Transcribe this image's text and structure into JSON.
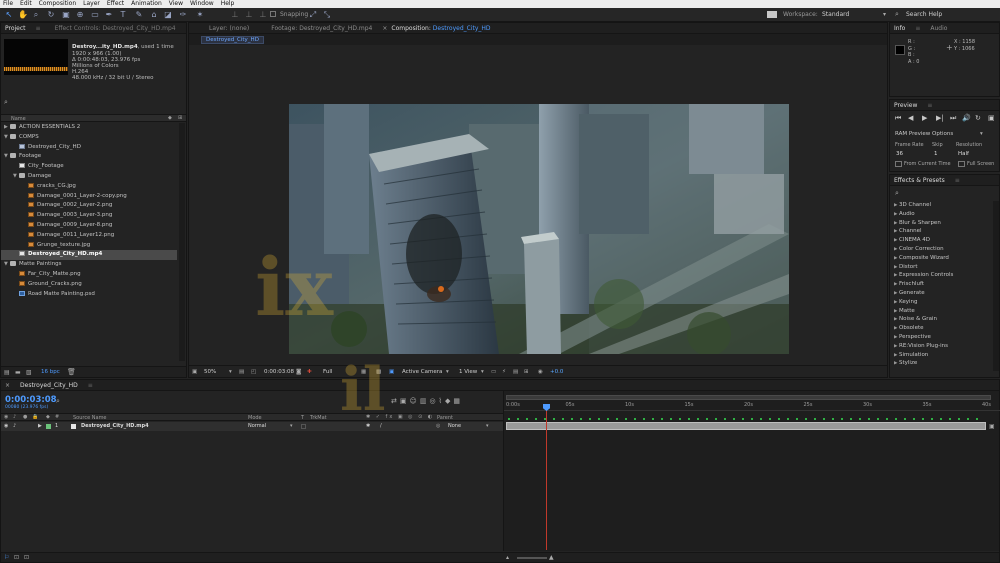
{
  "menu": [
    "File",
    "Edit",
    "Composition",
    "Layer",
    "Effect",
    "Animation",
    "View",
    "Window",
    "Help"
  ],
  "toolbar": {
    "tool_icons": [
      "selection-tool",
      "hand-tool",
      "zoom-tool",
      "rotate-tool",
      "camera-tool",
      "pan-behind-tool",
      "mask-tool",
      "pen-tool",
      "type-tool",
      "brush-tool",
      "clone-stamp-tool",
      "eraser-tool",
      "roto-brush-tool",
      "puppet-tool"
    ],
    "snapping_label": "Snapping",
    "workspace_label": "Workspace:",
    "workspace_value": "Standard",
    "search_placeholder": "Search Help"
  },
  "project_panel": {
    "tabs": [
      "Project",
      "Effect Controls: Destroyed_City_HD.mp4"
    ],
    "selected_name": "Destroy...ity_HD.mp4",
    "used_text": ", used 1 time",
    "meta": [
      "1920 x 966 (1.00)",
      "Δ 0:00:48:03, 23.976 fps",
      "Millions of Colors",
      "H.264",
      "48.000 kHz / 32 bit U / Stereo"
    ],
    "column_name": "Name",
    "items": [
      {
        "level": 0,
        "twirl": "right",
        "type": "folder",
        "name": "ACTION ESSENTIALS 2"
      },
      {
        "level": 0,
        "twirl": "down",
        "type": "folder",
        "name": "COMPS"
      },
      {
        "level": 1,
        "twirl": "",
        "type": "comp",
        "name": "Destroyed_City_HD"
      },
      {
        "level": 0,
        "twirl": "down",
        "type": "folder",
        "name": "Footage"
      },
      {
        "level": 1,
        "twirl": "",
        "type": "vid",
        "name": "City_Footage"
      },
      {
        "level": 1,
        "twirl": "down",
        "type": "folder",
        "name": "Damage"
      },
      {
        "level": 2,
        "twirl": "",
        "type": "img",
        "name": "cracks_CG.jpg"
      },
      {
        "level": 2,
        "twirl": "",
        "type": "img",
        "name": "Damage_0001_Layer-2-copy.png"
      },
      {
        "level": 2,
        "twirl": "",
        "type": "img",
        "name": "Damage_0002_Layer-2.png"
      },
      {
        "level": 2,
        "twirl": "",
        "type": "img",
        "name": "Damage_0003_Layer-3.png"
      },
      {
        "level": 2,
        "twirl": "",
        "type": "img",
        "name": "Damage_0009_Layer-8.png"
      },
      {
        "level": 2,
        "twirl": "",
        "type": "img",
        "name": "Damage_0011_Layer12.png"
      },
      {
        "level": 2,
        "twirl": "",
        "type": "img",
        "name": "Grunge_texture.jpg"
      },
      {
        "level": 1,
        "twirl": "",
        "type": "vid",
        "name": "Destroyed_City_HD.mp4",
        "selected": true
      },
      {
        "level": 0,
        "twirl": "down",
        "type": "folder",
        "name": "Matte Paintings"
      },
      {
        "level": 1,
        "twirl": "",
        "type": "img",
        "name": "Far_City_Matte.png"
      },
      {
        "level": 1,
        "twirl": "",
        "type": "img",
        "name": "Ground_Cracks.png"
      },
      {
        "level": 1,
        "twirl": "",
        "type": "psd",
        "name": "Road Matte Painting.psd"
      }
    ],
    "bpc": "16 bpc"
  },
  "viewer": {
    "tabs": [
      {
        "label": "Layer: (none)"
      },
      {
        "label": "Footage: Destroyed_City_HD.mp4"
      },
      {
        "label": "Composition: ",
        "highlight": "Destroyed_City_HD"
      }
    ],
    "sub_tab": "Destroyed_City_HD",
    "zoom": "50%",
    "timecode": "0:00:03:08",
    "resolution": "Full",
    "camera": "Active Camera",
    "views": "1 View",
    "exposure": "+0.0"
  },
  "info_panel": {
    "tabs": [
      "Info",
      "Audio"
    ],
    "channels": [
      "R :",
      "G :",
      "B :",
      "A : 0"
    ],
    "x": "X : 1158",
    "y": "Y : 1066"
  },
  "preview_panel": {
    "title": "Preview",
    "ram_options": "RAM Preview Options",
    "frame_rate_label": "Frame Rate",
    "skip_label": "Skip",
    "resolution_label": "Resolution",
    "frame_rate_value": "36",
    "skip_value": "1",
    "resolution_value": "Half",
    "from_current": "From Current Time",
    "full_screen": "Full Screen"
  },
  "effects_panel": {
    "title": "Effects & Presets",
    "categories": [
      "3D Channel",
      "Audio",
      "Blur & Sharpen",
      "Channel",
      "CINEMA 4D",
      "Color Correction",
      "Composite Wizard",
      "Distort",
      "Expression Controls",
      "Frischluft",
      "Generate",
      "Keying",
      "Matte",
      "Noise & Grain",
      "Obsolete",
      "Perspective",
      "RE:Vision Plug-ins",
      "Simulation",
      "Stylize"
    ]
  },
  "timeline": {
    "tab": "Destroyed_City_HD",
    "timecode": "0:00:03:08",
    "frames_fps": "00080 (23.976 fps)",
    "columns": {
      "source_name": "Source Name",
      "mode": "Mode",
      "t": "T",
      "trkmat": "TrkMat",
      "parent": "Parent"
    },
    "layer": {
      "index": "1",
      "name": "Destroyed_City_HD.mp4",
      "mode": "Normal",
      "parent": "None"
    },
    "ruler": [
      "0:00s",
      "05s",
      "10s",
      "15s",
      "20s",
      "25s",
      "30s",
      "35s",
      "40s"
    ]
  },
  "colors": {
    "accent": "#4e9bff",
    "playhead": "#c0392b",
    "cache": "#2fb044",
    "audio_wave": "#e2901f"
  }
}
